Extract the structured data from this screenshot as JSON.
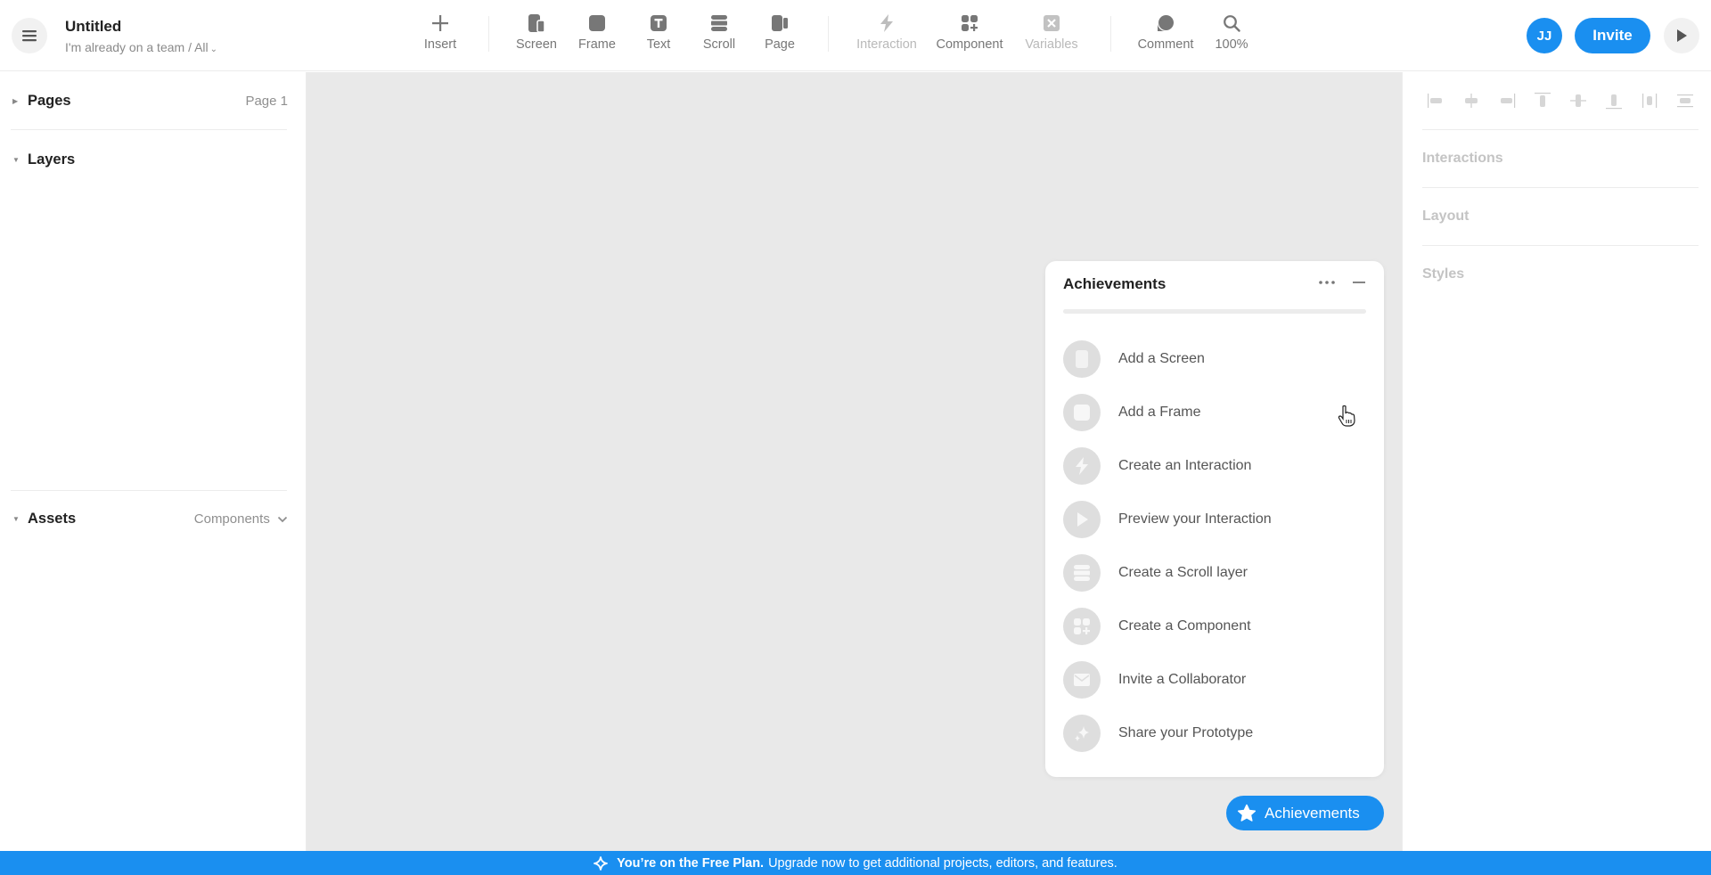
{
  "header": {
    "title": "Untitled",
    "subtitle": "I'm already on a team / All",
    "menu_icon": "hamburger-icon",
    "tools": [
      {
        "label": "Insert",
        "icon": "plus-icon",
        "enabled": true
      },
      {
        "label": "Screen",
        "icon": "screen-icon",
        "enabled": true
      },
      {
        "label": "Frame",
        "icon": "frame-icon",
        "enabled": true
      },
      {
        "label": "Text",
        "icon": "text-icon",
        "enabled": true
      },
      {
        "label": "Scroll",
        "icon": "scroll-icon",
        "enabled": true
      },
      {
        "label": "Page",
        "icon": "page-icon",
        "enabled": true
      },
      {
        "label": "Interaction",
        "icon": "lightning-icon",
        "enabled": false
      },
      {
        "label": "Component",
        "icon": "component-icon",
        "enabled": true
      },
      {
        "label": "Variables",
        "icon": "variables-icon",
        "enabled": false
      },
      {
        "label": "Comment",
        "icon": "comment-icon",
        "enabled": true
      },
      {
        "label": "100%",
        "icon": "zoom-icon",
        "enabled": true
      }
    ],
    "avatar_initials": "JJ",
    "invite_label": "Invite",
    "accent": "#1a8ff0"
  },
  "left_panel": {
    "pages": {
      "label": "Pages",
      "current": "Page 1",
      "expanded": false
    },
    "layers": {
      "label": "Layers",
      "expanded": true
    },
    "assets": {
      "label": "Assets",
      "filter": "Components",
      "expanded": true
    }
  },
  "right_panel": {
    "align_tools": [
      "align-left",
      "align-center-horizontal",
      "align-right",
      "align-top",
      "align-center-vertical",
      "align-bottom",
      "distribute-horizontal",
      "distribute-vertical"
    ],
    "sections": [
      "Interactions",
      "Layout",
      "Styles"
    ]
  },
  "achievements": {
    "title": "Achievements",
    "progress": 0,
    "items": [
      {
        "label": "Add a Screen",
        "icon": "screen-icon"
      },
      {
        "label": "Add a Frame",
        "icon": "frame-icon"
      },
      {
        "label": "Create an Interaction",
        "icon": "lightning-icon"
      },
      {
        "label": "Preview your Interaction",
        "icon": "play-icon"
      },
      {
        "label": "Create a Scroll layer",
        "icon": "scroll-icon"
      },
      {
        "label": "Create a Component",
        "icon": "component-icon"
      },
      {
        "label": "Invite a Collaborator",
        "icon": "mail-icon"
      },
      {
        "label": "Share your Prototype",
        "icon": "sparkle-icon"
      }
    ],
    "button_label": "Achievements"
  },
  "banner": {
    "bold": "You’re on the Free Plan.",
    "text": "Upgrade now to get additional projects, editors, and features."
  }
}
